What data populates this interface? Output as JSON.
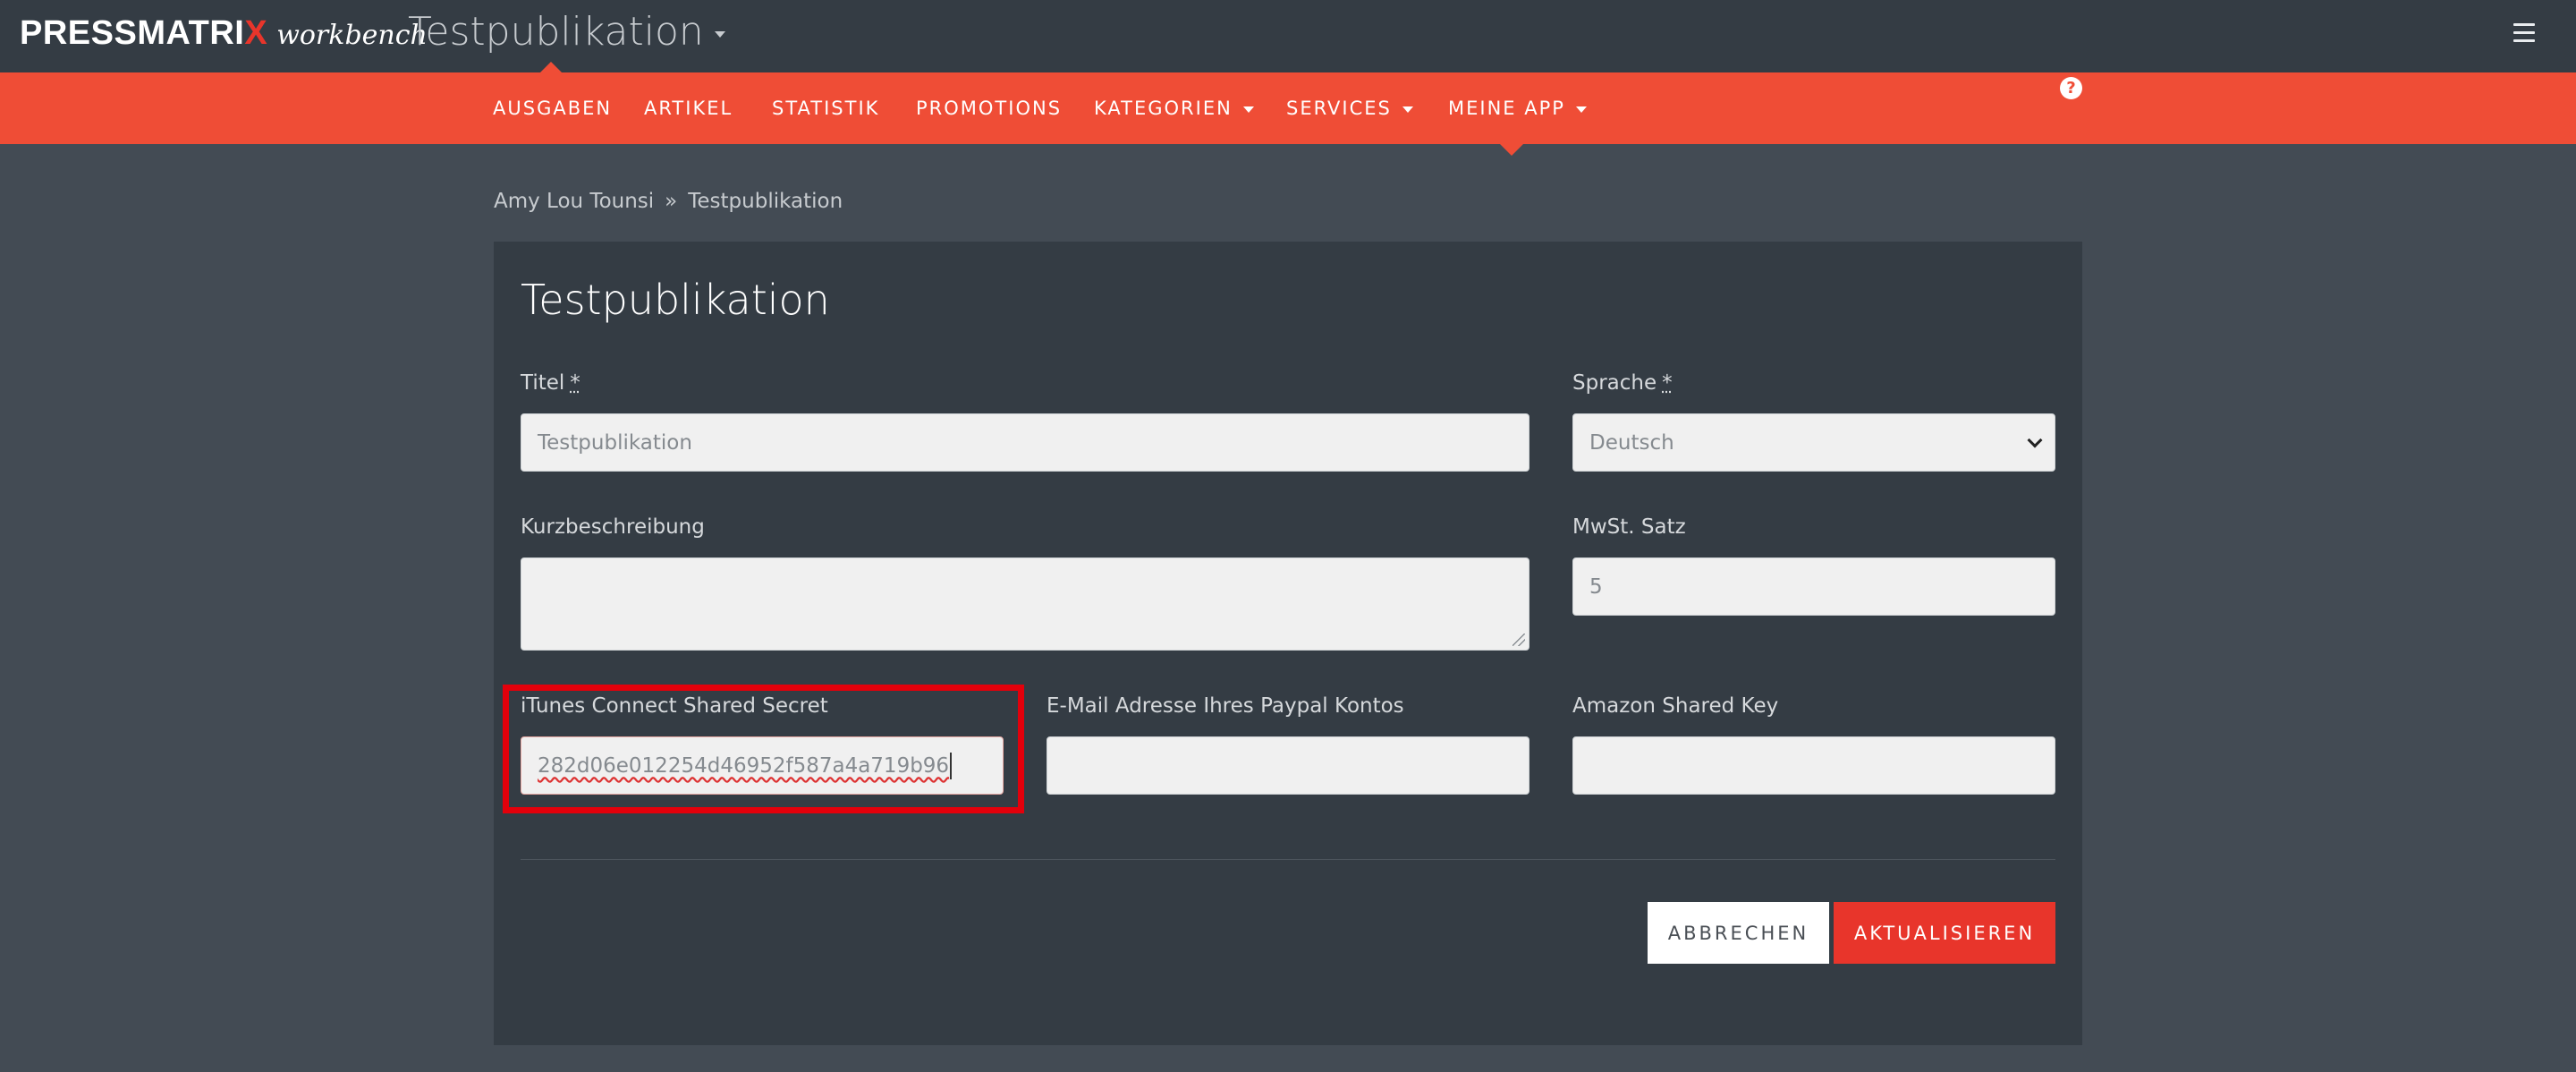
{
  "header": {
    "logo_main": "PRESSMATRI",
    "logo_x": "X",
    "logo_sub": "workbench",
    "publication_title": "Testpublikation",
    "menu_icon": "hamburger-icon"
  },
  "nav": {
    "items": [
      {
        "label": "AUSGABEN",
        "dropdown": false
      },
      {
        "label": "ARTIKEL",
        "dropdown": false
      },
      {
        "label": "STATISTIK",
        "dropdown": false
      },
      {
        "label": "PROMOTIONS",
        "dropdown": false
      },
      {
        "label": "KATEGORIEN",
        "dropdown": true
      },
      {
        "label": "SERVICES",
        "dropdown": true
      },
      {
        "label": "MEINE APP",
        "dropdown": true
      }
    ],
    "help": "?",
    "help_icon": "question-circle-icon"
  },
  "breadcrumb": {
    "user": "Amy Lou Tounsi",
    "separator": "»",
    "current": "Testpublikation"
  },
  "form": {
    "title": "Testpublikation",
    "required_marker": "*",
    "titel": {
      "label": "Titel",
      "value": "Testpublikation"
    },
    "sprache": {
      "label": "Sprache",
      "value": "Deutsch"
    },
    "kurzbeschreibung": {
      "label": "Kurzbeschreibung",
      "value": ""
    },
    "mwst": {
      "label": "MwSt. Satz",
      "value": "5"
    },
    "itunes": {
      "label": "iTunes Connect Shared Secret",
      "value": "282d06e012254d46952f587a4a719b96"
    },
    "paypal": {
      "label": "E-Mail Adresse Ihres Paypal Kontos",
      "value": ""
    },
    "amazon": {
      "label": "Amazon Shared Key",
      "value": ""
    },
    "cancel_label": "ABBRECHEN",
    "update_label": "AKTUALISIEREN"
  },
  "colors": {
    "accent": "#ef4d36",
    "primary_button": "#e8352b",
    "highlight": "#e3000b",
    "topbar": "#343c44",
    "page_bg": "#434b54"
  }
}
